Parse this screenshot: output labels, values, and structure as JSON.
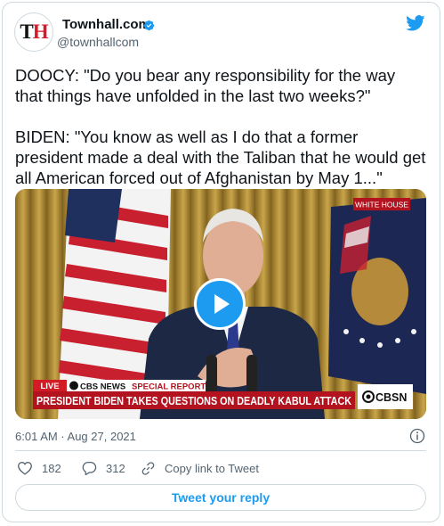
{
  "author": {
    "name": "Townhall.com",
    "handle": "@townhallcom",
    "avatar_text_1": "T",
    "avatar_text_2": "H"
  },
  "tweet": {
    "paragraph1": "DOOCY: \"Do you bear any responsibility for the way that things have unfolded in the last two weeks?\"",
    "paragraph2": "BIDEN: \"You know as well as I do that a former president made a deal with the Taliban that he would get all American forced out of Afghanistan by May 1...\"",
    "timestamp": "6:01 AM · Aug 27, 2021"
  },
  "video": {
    "corner_label": "WHITE HOUSE",
    "live_label": "LIVE",
    "network_label": "CBS NEWS",
    "special_label": "SPECIAL REPORT",
    "headline": "PRESIDENT BIDEN TAKES QUESTIONS ON DEADLY KABUL ATTACK",
    "logo": "CBSN"
  },
  "actions": {
    "likes": "182",
    "replies": "312",
    "copy_link": "Copy link to Tweet"
  },
  "reply_button": "Tweet your reply",
  "colors": {
    "accent": "#1d9bf0",
    "brand_red": "#d6192b",
    "text": "#0f1419",
    "muted": "#536471"
  },
  "icons": [
    "verified-badge-icon",
    "twitter-bird-icon",
    "play-icon",
    "info-icon",
    "heart-icon",
    "reply-icon",
    "link-icon"
  ]
}
